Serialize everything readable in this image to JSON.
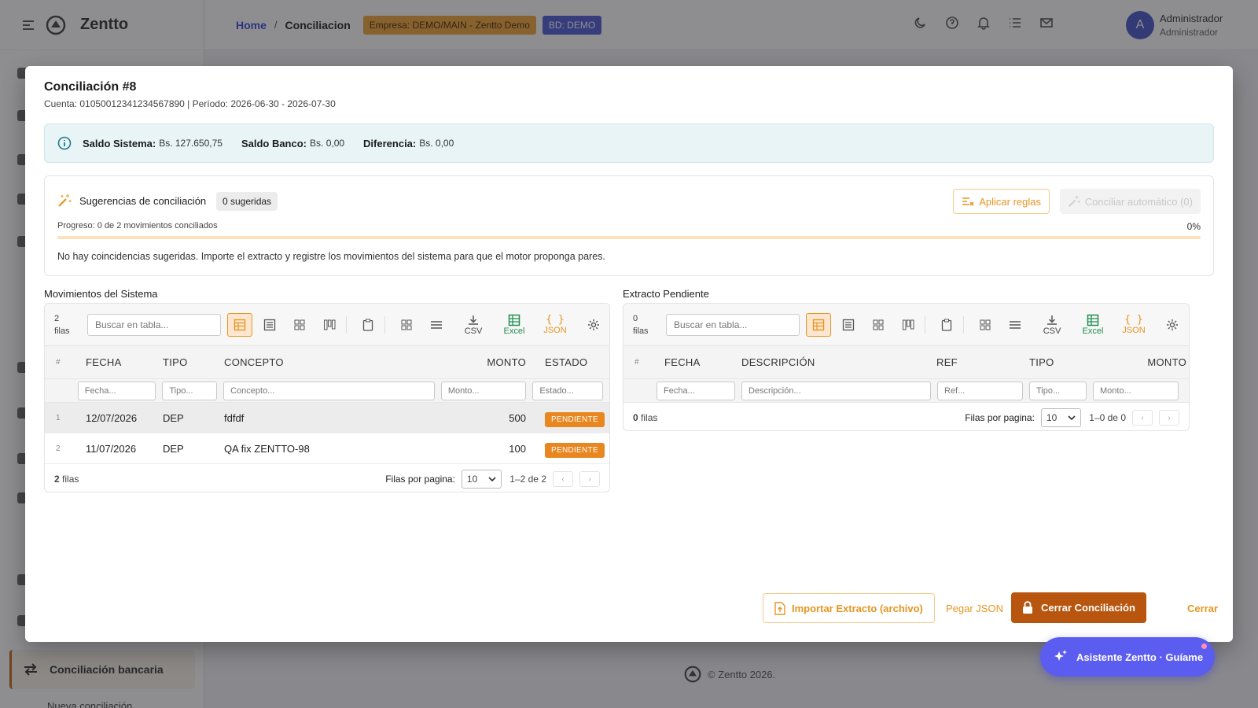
{
  "app": {
    "name": "Zentto",
    "footer": "© Zentto 2026."
  },
  "sidebar": {
    "active_item": "Conciliación bancaria",
    "next_item": "Nueva conciliación"
  },
  "header": {
    "breadcrumb_home": "Home",
    "breadcrumb_sep": "/",
    "breadcrumb_current": "Conciliacion",
    "company_chip": "Empresa: DEMO/MAIN - Zentto Demo",
    "db_chip": "BD: DEMO",
    "user_initial": "A",
    "user_name": "Administrador",
    "user_role": "Administrador"
  },
  "modal": {
    "title": "Conciliación #8",
    "subtitle": "Cuenta: 01050012341234567890 | Período: 2026-06-30 - 2026-07-30",
    "balances": {
      "sistema_label": "Saldo Sistema:",
      "sistema_value": "Bs. 127.650,75",
      "banco_label": "Saldo Banco:",
      "banco_value": "Bs. 0,00",
      "diferencia_label": "Diferencia:",
      "diferencia_value": "Bs. 0,00"
    },
    "suggestions": {
      "title": "Sugerencias de conciliación",
      "badge": "0 sugeridas",
      "apply_rules": "Aplicar reglas",
      "auto_reconcile": "Conciliar automático (0)",
      "progress_label": "Progreso: 0 de 2 movimientos conciliados",
      "progress_pct": "0%",
      "progress_value": 0,
      "message": "No hay coincidencias sugeridas. Importe el extracto y registre los movimientos del sistema para que el motor proponga pares."
    },
    "system_table": {
      "label": "Movimientos del Sistema",
      "count_num": "2",
      "count_word": "filas",
      "search_placeholder": "Buscar en tabla...",
      "csv": "CSV",
      "excel": "Excel",
      "json": "JSON",
      "headers": {
        "num": "#",
        "fecha": "FECHA",
        "tipo": "TIPO",
        "concepto": "CONCEPTO",
        "monto": "MONTO",
        "estado": "ESTADO"
      },
      "filters": {
        "fecha": "Fecha...",
        "tipo": "Tipo...",
        "concepto": "Concepto...",
        "monto": "Monto...",
        "estado": "Estado..."
      },
      "rows": [
        {
          "num": "1",
          "fecha": "12/07/2026",
          "tipo": "DEP",
          "concepto": "fdfdf",
          "monto": "500",
          "estado": "PENDIENTE"
        },
        {
          "num": "2",
          "fecha": "11/07/2026",
          "tipo": "DEP",
          "concepto": "QA fix ZENTTO-98",
          "monto": "100",
          "estado": "PENDIENTE"
        }
      ],
      "footer_count": "2",
      "footer_word": "filas",
      "rows_per_page_label": "Filas por pagina:",
      "rows_per_page": "10",
      "range": "1–2 de 2"
    },
    "bank_table": {
      "label": "Extracto Pendiente",
      "count_num": "0",
      "count_word": "filas",
      "search_placeholder": "Buscar en tabla...",
      "csv": "CSV",
      "excel": "Excel",
      "json": "JSON",
      "headers": {
        "num": "#",
        "fecha": "FECHA",
        "descripcion": "DESCRIPCIÓN",
        "ref": "REF",
        "tipo": "TIPO",
        "monto": "MONTO"
      },
      "filters": {
        "fecha": "Fecha...",
        "descripcion": "Descripción...",
        "ref": "Ref...",
        "tipo": "Tipo...",
        "monto": "Monto..."
      },
      "footer_count": "0",
      "footer_word": "filas",
      "rows_per_page_label": "Filas por pagina:",
      "rows_per_page": "10",
      "range": "1–0 de 0"
    },
    "actions": {
      "import": "Importar Extracto (archivo)",
      "paste_json": "Pegar JSON",
      "close_reconciliation": "Cerrar Conciliación",
      "close": "Cerrar"
    }
  },
  "assistant": {
    "label": "Asistente Zentto · Guíame"
  },
  "colors": {
    "accent": "#e69622",
    "primary": "#4f5bd5",
    "danger_dark": "#b8560f"
  }
}
